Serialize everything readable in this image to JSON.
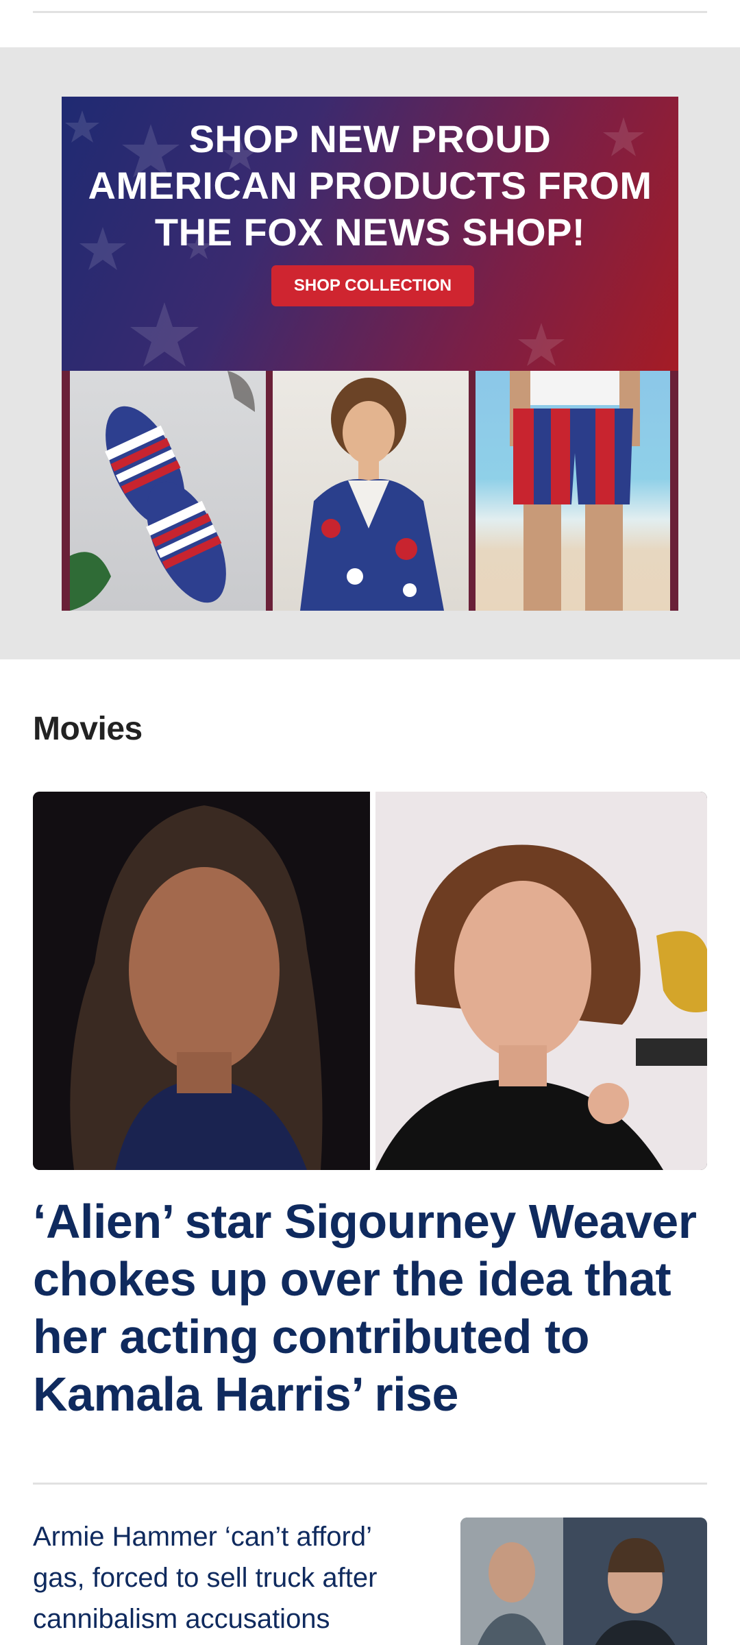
{
  "ad": {
    "headline": "SHOP NEW PROUD\nAMERICAN PRODUCTS FROM\nTHE FOX NEWS SHOP!",
    "cta_label": "SHOP COLLECTION",
    "colors": {
      "gradient_start": "#1f2a72",
      "gradient_end": "#a51c25",
      "cta": "#cf2530"
    }
  },
  "section": {
    "title": "Movies"
  },
  "lead_story": {
    "headline": "‘Alien’ star Sigourney Weaver chokes up over the idea that her acting contributed to Kamala Harris’ rise"
  },
  "secondary_story": {
    "headline": "Armie Hammer ‘can’t afford’ gas, forced to sell truck after cannibalism accusations"
  },
  "colors": {
    "headline": "#0f2a5e",
    "section_title": "#222222",
    "ad_background": "#e5e5e5",
    "divider": "#e1e1e1"
  }
}
